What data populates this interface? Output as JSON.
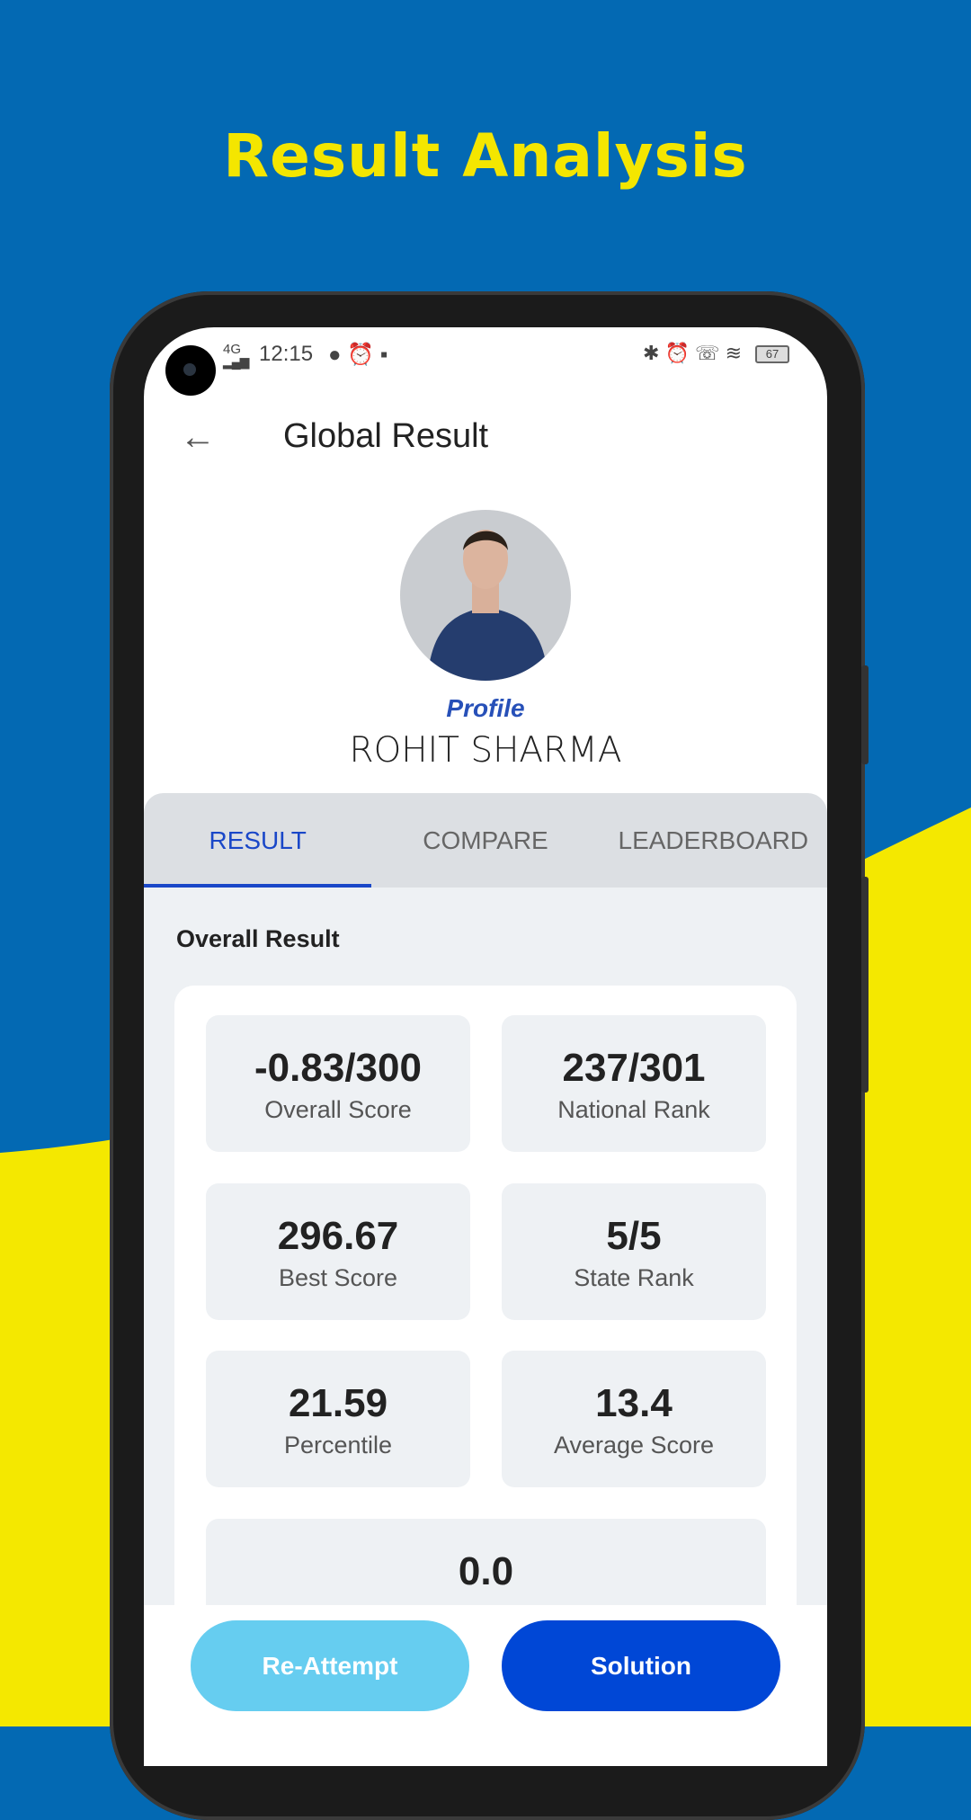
{
  "headline": "Result Analysis",
  "colors": {
    "background_blue": "#0369b3",
    "wave_yellow": "#f4e800",
    "accent": "#1a47c8",
    "reattempt": "#66cdf0",
    "solution": "#0047d6"
  },
  "status_bar": {
    "time": "12:15",
    "network": "4G",
    "battery": "67"
  },
  "app_bar": {
    "title": "Global Result",
    "back_icon": "arrow-left-icon"
  },
  "profile": {
    "logo_text": "Profile",
    "name": "ROHIT SHARMA"
  },
  "tabs": [
    {
      "label": "RESULT",
      "active": true
    },
    {
      "label": "COMPARE"
    },
    {
      "label": "LEADERBOARD"
    }
  ],
  "section_title": "Overall Result",
  "stats": [
    {
      "value": "-0.83/300",
      "label": "Overall Score"
    },
    {
      "value": "237/301",
      "label": "National Rank"
    },
    {
      "value": "296.67",
      "label": "Best Score"
    },
    {
      "value": "5/5",
      "label": "State Rank"
    },
    {
      "value": "21.59",
      "label": "Percentile"
    },
    {
      "value": "13.4",
      "label": "Average Score"
    },
    {
      "value": "0.0"
    }
  ],
  "buttons": {
    "reattempt": "Re-Attempt",
    "solution": "Solution"
  }
}
